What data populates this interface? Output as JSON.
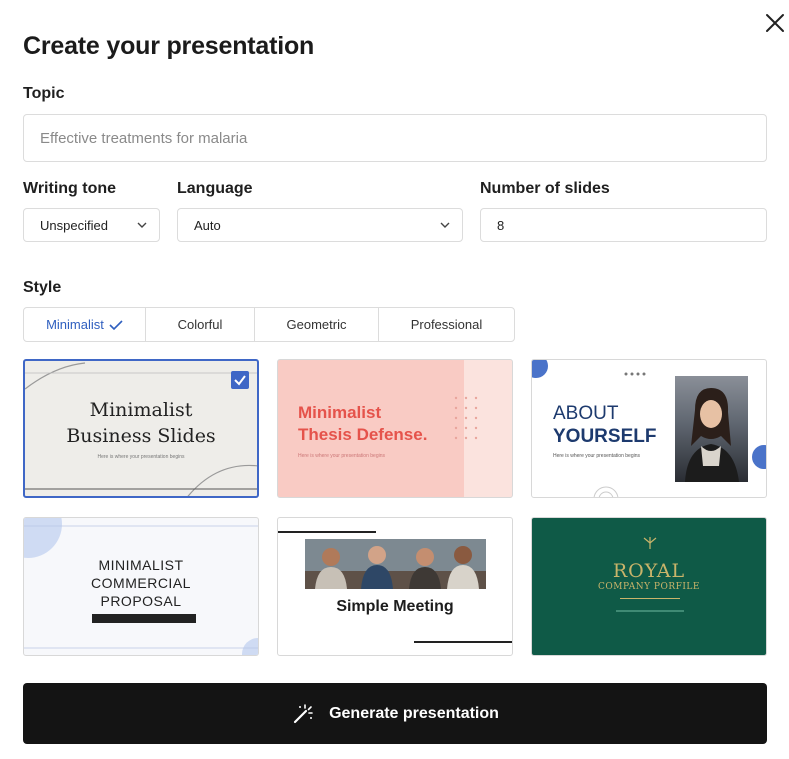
{
  "dialog": {
    "title": "Create your presentation"
  },
  "topic": {
    "label": "Topic",
    "placeholder": "Effective treatments for malaria",
    "value": ""
  },
  "writing_tone": {
    "label": "Writing tone",
    "value": "Unspecified"
  },
  "language": {
    "label": "Language",
    "value": "Auto"
  },
  "slides": {
    "label": "Number of slides",
    "value": "8"
  },
  "style": {
    "label": "Style",
    "tabs": [
      {
        "label": "Minimalist",
        "active": true
      },
      {
        "label": "Colorful",
        "active": false
      },
      {
        "label": "Geometric",
        "active": false
      },
      {
        "label": "Professional",
        "active": false
      }
    ]
  },
  "templates": [
    {
      "line1": "Minimalist",
      "line2": "Business Slides",
      "sub": "Here is where your presentation begins",
      "selected": true
    },
    {
      "line1": "Minimalist",
      "line2": "Thesis Defense.",
      "sub": "Here is where your presentation begins"
    },
    {
      "line1": "ABOUT",
      "line2": "YOURSELF",
      "sub": "Here is where your presentation begins"
    },
    {
      "line1": "MINIMALIST",
      "line2": "COMMERCIAL",
      "line3": "PROPOSAL"
    },
    {
      "line1": "Simple Meeting"
    },
    {
      "line1": "ROYAL",
      "line2": "COMPANY PORFILE"
    }
  ],
  "generate": {
    "label": "Generate presentation"
  },
  "colors": {
    "accent": "#3f67c6",
    "button_bg": "#141414",
    "salmon": "#f9cbc4",
    "salmon_text": "#e5534b",
    "navy": "#1d3a6e",
    "green": "#0f5a47",
    "gold": "#c9b46a"
  }
}
